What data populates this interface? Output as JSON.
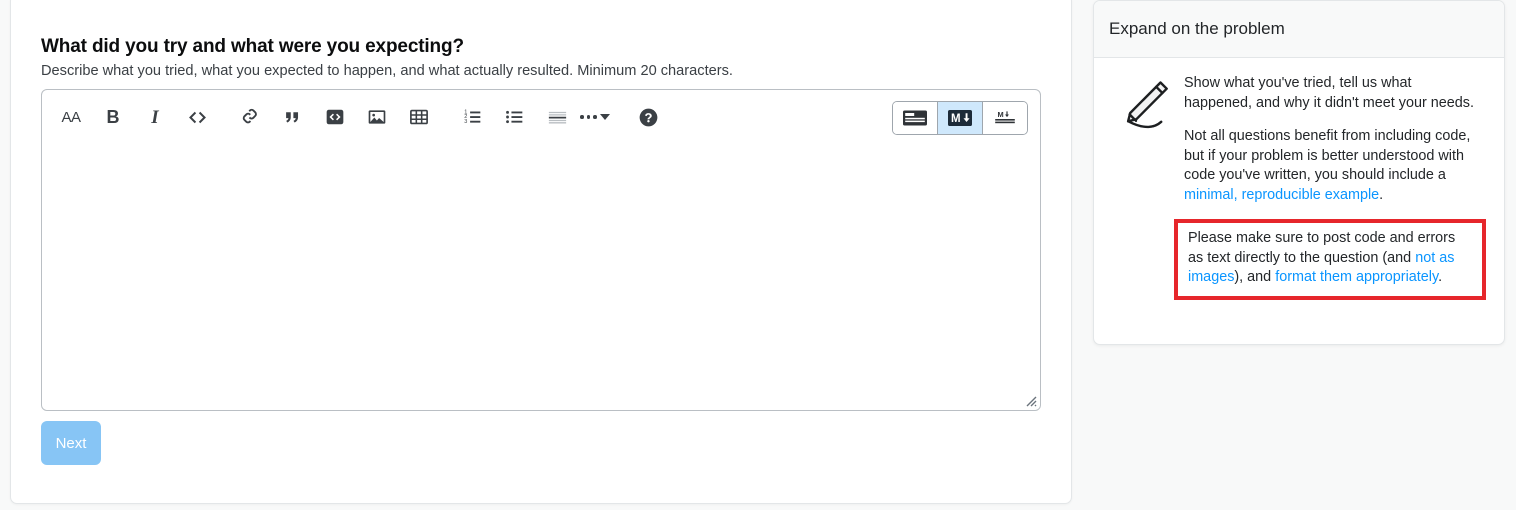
{
  "form": {
    "label": "What did you try and what were you expecting?",
    "help": "Describe what you tried, what you expected to happen, and what actually resulted. Minimum 20 characters.",
    "next_label": "Next",
    "textarea_value": "",
    "textarea_placeholder": ""
  },
  "toolbar": {
    "items": [
      {
        "name": "heading-icon",
        "label": "AA"
      },
      {
        "name": "bold-icon",
        "label": "B"
      },
      {
        "name": "italic-icon",
        "label": "I"
      },
      {
        "name": "inline-code-icon",
        "label": "<>"
      },
      {
        "name": "link-icon",
        "label": "link"
      },
      {
        "name": "blockquote-icon",
        "label": "quote"
      },
      {
        "name": "code-block-icon",
        "label": "code block"
      },
      {
        "name": "image-icon",
        "label": "image"
      },
      {
        "name": "table-icon",
        "label": "table"
      },
      {
        "name": "ordered-list-icon",
        "label": "numbered list"
      },
      {
        "name": "bulleted-list-icon",
        "label": "bulleted list"
      },
      {
        "name": "horizontal-rule-icon",
        "label": "horizontal rule"
      },
      {
        "name": "more-icon",
        "label": "more"
      },
      {
        "name": "help-icon",
        "label": "help"
      }
    ],
    "modes": [
      {
        "name": "rich-text-mode-button",
        "label": "Rich text",
        "active": false
      },
      {
        "name": "markdown-mode-button",
        "label": "M",
        "active": true
      },
      {
        "name": "preview-mode-button",
        "label": "M",
        "active": false
      }
    ]
  },
  "sidebar": {
    "title": "Expand on the problem",
    "icon": "pencil-icon",
    "paragraph1": "Show what you've tried, tell us what happened, and why it didn't meet your needs.",
    "paragraph2": {
      "before": "Not all questions benefit from including code, but if your problem is better understood with code you've written, you should include a ",
      "link": "minimal, reproducible example",
      "after": "."
    },
    "highlighted": {
      "before": "Please make sure to post code and errors as text directly to the question (and ",
      "link1": "not as images",
      "middle": "), and ",
      "link2": "format them appropriately",
      "after": "."
    }
  },
  "colors": {
    "link": "#0a95ff",
    "highlight_border": "#e6262b",
    "next_button": "#87c5f5",
    "toolbar_icon": "#3b4045",
    "mode_active_bg": "#cfe8fc"
  }
}
